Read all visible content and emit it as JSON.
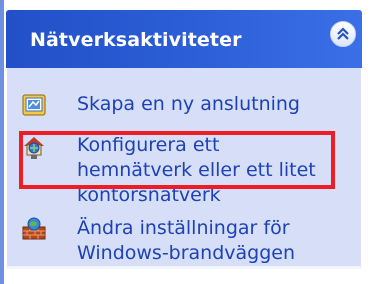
{
  "panel": {
    "title": "Nätverksaktiviteter",
    "collapse_icon": "double-chevron-up-icon"
  },
  "tasks": [
    {
      "label_lines": [
        "Skapa en ny anslutning"
      ],
      "icon": "new-connection-icon"
    },
    {
      "label_lines": [
        "Konfigurera ett",
        "hemnätverk eller ett litet",
        "kontorsnätverk"
      ],
      "icon": "home-network-icon"
    },
    {
      "label_lines": [
        "Ändra inställningar för",
        "Windows-brandväggen"
      ],
      "icon": "firewall-icon"
    }
  ],
  "colors": {
    "header_blue": "#2c5fd8",
    "body_blue": "#d6dff7",
    "link_blue": "#1d42b6",
    "highlight_red": "#ee1c25"
  }
}
